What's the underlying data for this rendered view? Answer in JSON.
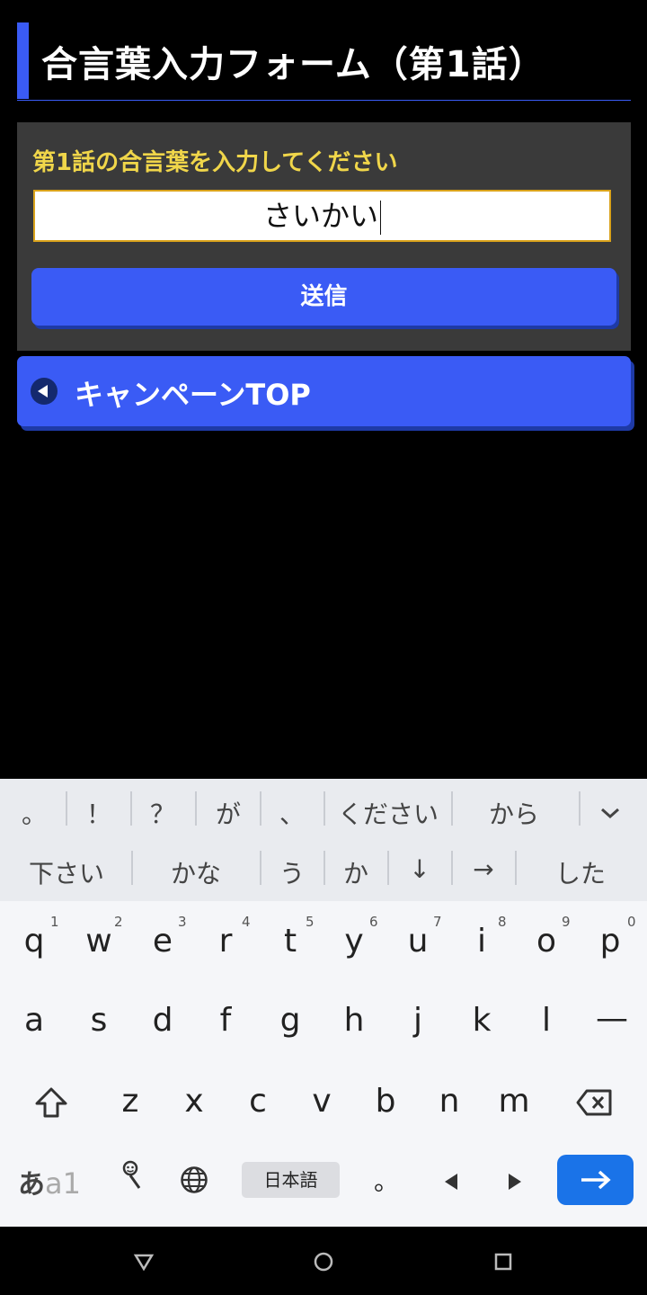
{
  "page": {
    "title": "合言葉入力フォーム（第1話）",
    "form_label": "第1話の合言葉を入力してください",
    "input_value": "さいかい",
    "submit_label": "送信",
    "top_button_label": "キャンペーンTOP"
  },
  "keyboard": {
    "suggestions_row1": [
      "。",
      "！",
      "？",
      "が",
      "、",
      "ください",
      "から"
    ],
    "suggestions_row2": [
      "下さい",
      "かな",
      "う",
      "か",
      "↓",
      "→",
      "した"
    ],
    "row1": [
      {
        "key": "q",
        "hint": "1"
      },
      {
        "key": "w",
        "hint": "2"
      },
      {
        "key": "e",
        "hint": "3"
      },
      {
        "key": "r",
        "hint": "4"
      },
      {
        "key": "t",
        "hint": "5"
      },
      {
        "key": "y",
        "hint": "6"
      },
      {
        "key": "u",
        "hint": "7"
      },
      {
        "key": "i",
        "hint": "8"
      },
      {
        "key": "o",
        "hint": "9"
      },
      {
        "key": "p",
        "hint": "0"
      }
    ],
    "row2": [
      "a",
      "s",
      "d",
      "f",
      "g",
      "h",
      "j",
      "k",
      "l",
      "—"
    ],
    "row3": [
      "z",
      "x",
      "c",
      "v",
      "b",
      "n",
      "m"
    ],
    "mode_label_kana": "あ",
    "mode_label_alpha": "a1",
    "space_label": "日本語",
    "period_key": "。",
    "icons": {
      "shift": "shift-icon",
      "backspace": "backspace-icon",
      "mic": "voice-search-icon",
      "globe": "globe-icon",
      "left": "cursor-left-icon",
      "right": "cursor-right-icon",
      "enter": "enter-arrow-icon",
      "collapse": "chevron-down-icon"
    },
    "accent_color": "#1a73e8"
  },
  "colors": {
    "accent": "#3a5bf5",
    "label_yellow": "#f0d64a",
    "input_border": "#d9a21b",
    "panel": "#3a3a3a"
  }
}
